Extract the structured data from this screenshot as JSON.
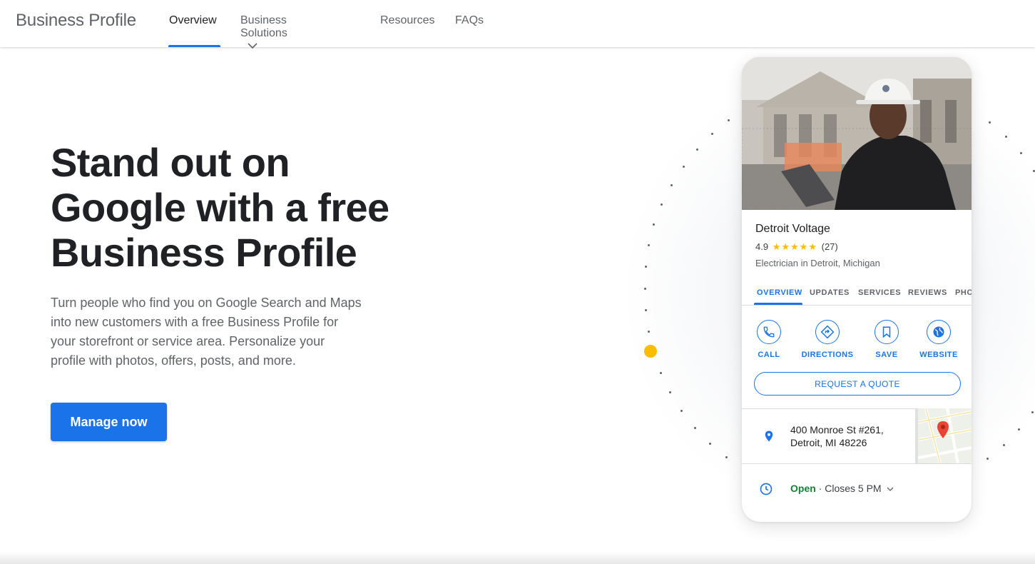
{
  "header": {
    "brand": "Business Profile",
    "nav": [
      {
        "label": "Overview",
        "active": true
      },
      {
        "label": "Business Solutions",
        "has_dropdown": true
      },
      {
        "label": "Resources"
      },
      {
        "label": "FAQs"
      }
    ]
  },
  "hero": {
    "title_lines": [
      "Stand out on",
      "Google with a free",
      "Business Profile"
    ],
    "description_lines": [
      "Turn people who find you on Google Search and Maps",
      "into new customers with a free Business Profile for",
      "your storefront or service area. Personalize your",
      "profile with photos, offers, posts, and more."
    ],
    "cta_label": "Manage now"
  },
  "profile_card": {
    "name": "Detroit Voltage",
    "rating": "4.9",
    "stars": "★★★★★",
    "review_count": "(27)",
    "category": "Electrician in Detroit, Michigan",
    "tabs": [
      "OVERVIEW",
      "UPDATES",
      "SERVICES",
      "REVIEWS",
      "PHO"
    ],
    "active_tab": "OVERVIEW",
    "actions": [
      {
        "label": "CALL",
        "icon": "phone-icon"
      },
      {
        "label": "DIRECTIONS",
        "icon": "directions-icon"
      },
      {
        "label": "SAVE",
        "icon": "bookmark-icon"
      },
      {
        "label": "WEBSITE",
        "icon": "globe-icon"
      }
    ],
    "quote_button": "REQUEST A QUOTE",
    "address_line1": "400 Monroe St #261,",
    "address_line2": "Detroit, MI 48226",
    "hours_status": "Open",
    "hours_detail": " · Closes 5 PM"
  },
  "colors": {
    "accent": "#1a73e8",
    "open_green": "#188038",
    "star_yellow": "#fbbc04"
  }
}
